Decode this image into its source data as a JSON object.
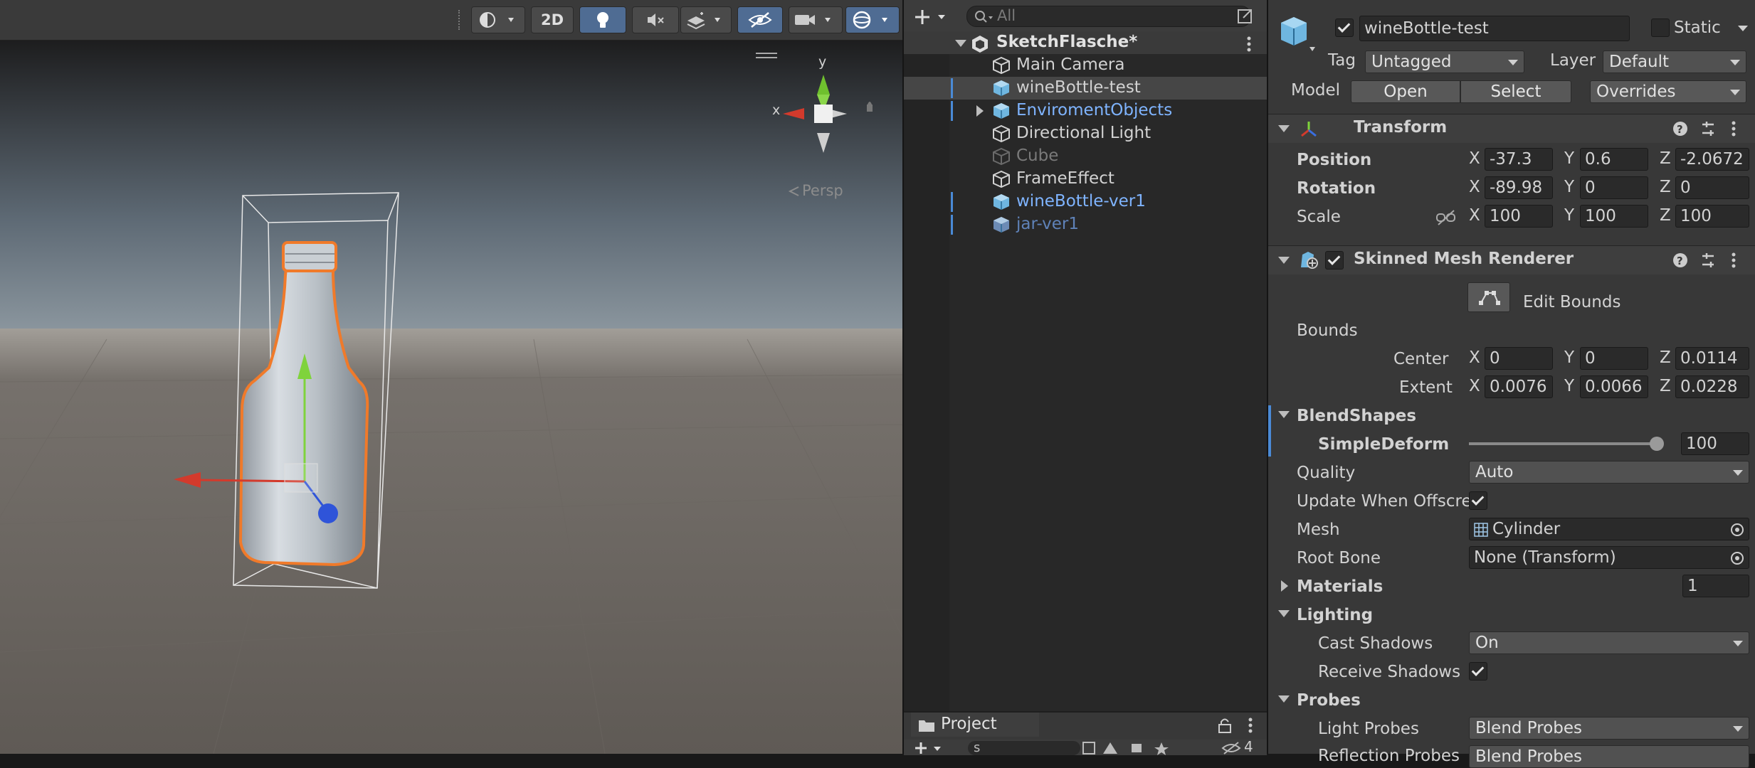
{
  "scene_toolbar": {
    "mode_2d": "2D"
  },
  "scene": {
    "axis_x": "x",
    "axis_y": "y",
    "projection": "Persp"
  },
  "hierarchy": {
    "search_placeholder": "All",
    "scene_name": "SketchFlasche*",
    "items": [
      {
        "label": "Main Camera",
        "color": "#d2d2d2"
      },
      {
        "label": "wineBottle-test",
        "color": "#d2d2d2"
      },
      {
        "label": "EnviromentObjects",
        "color": "#7fb4ff"
      },
      {
        "label": "Directional Light",
        "color": "#d2d2d2"
      },
      {
        "label": "Cube",
        "color": "#7a7a7a"
      },
      {
        "label": "FrameEffect",
        "color": "#d2d2d2"
      },
      {
        "label": "wineBottle-ver1",
        "color": "#7fb4ff"
      },
      {
        "label": "jar-ver1",
        "color": "#5f82b8"
      }
    ]
  },
  "project": {
    "tab_label": "Project",
    "search_value": "s",
    "count": "4"
  },
  "inspector": {
    "object_name": "wineBottle-test",
    "static_label": "Static",
    "tag_label": "Tag",
    "tag_value": "Untagged",
    "layer_label": "Layer",
    "layer_value": "Default",
    "model_label": "Model",
    "open_button": "Open",
    "select_button": "Select",
    "overrides_label": "Overrides",
    "transform": {
      "title": "Transform",
      "position_label": "Position",
      "position": [
        "-37.3",
        "0.6",
        "-2.0672"
      ],
      "rotation_label": "Rotation",
      "rotation": [
        "-89.98",
        "0",
        "0"
      ],
      "scale_label": "Scale",
      "scale": [
        "100",
        "100",
        "100"
      ]
    },
    "axes": [
      "X",
      "Y",
      "Z"
    ],
    "smr": {
      "title": "Skinned Mesh Renderer",
      "edit_bounds": "Edit Bounds",
      "bounds_label": "Bounds",
      "center_label": "Center",
      "center": [
        "0",
        "0",
        "0.0114"
      ],
      "extent_label": "Extent",
      "extent": [
        "0.0076",
        "0.0066",
        "0.0228"
      ],
      "blendshapes_label": "BlendShapes",
      "simpledeform_label": "SimpleDeform",
      "simpledeform_value": "100",
      "simpledeform_fraction": 1.0,
      "quality_label": "Quality",
      "quality_value": "Auto",
      "update_offscreen_label": "Update When Offscre",
      "mesh_label": "Mesh",
      "mesh_value": "Cylinder",
      "rootbone_label": "Root Bone",
      "rootbone_value": "None (Transform)",
      "materials_label": "Materials",
      "materials_count": "1",
      "lighting_label": "Lighting",
      "cast_shadows_label": "Cast Shadows",
      "cast_shadows_value": "On",
      "receive_shadows_label": "Receive Shadows",
      "probes_label": "Probes",
      "light_probes_label": "Light Probes",
      "light_probes_value": "Blend Probes",
      "reflection_probes_label": "Reflection Probes",
      "reflection_probes_value": "Blend Probes"
    }
  },
  "colors": {
    "accent": "#4a8ad6",
    "gizmo_x": "#d33a2c",
    "gizmo_y": "#7fd33c",
    "gizmo_z": "#2f54d9",
    "selection_outline": "#f07a2a"
  }
}
